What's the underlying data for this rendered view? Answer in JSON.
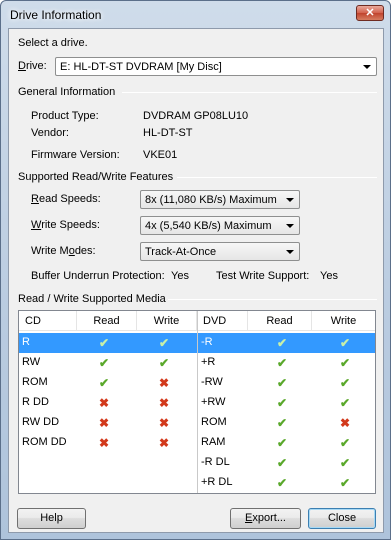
{
  "window": {
    "title": "Drive Information",
    "close_glyph": "✕"
  },
  "select_prompt": "Select a drive.",
  "drive": {
    "label_first": "D",
    "label_rest": "rive:",
    "value": "E: HL-DT-ST DVDRAM    [My Disc]"
  },
  "general": {
    "heading": "General Information",
    "product_type_label": "Product Type:",
    "product_type_value": "DVDRAM GP08LU10",
    "vendor_label": "Vendor:",
    "vendor_value": "HL-DT-ST",
    "firmware_label": "Firmware Version:",
    "firmware_value": "VKE01"
  },
  "rw_features": {
    "heading": "Supported Read/Write Features",
    "read_speeds_first": "R",
    "read_speeds_rest": "ead Speeds:",
    "read_speeds_value": "8x (11,080 KB/s)  Maximum",
    "write_speeds_first": "W",
    "write_speeds_rest": "rite Speeds:",
    "write_speeds_value": "4x (5,540 KB/s)  Maximum",
    "write_modes_label_a": "Write M",
    "write_modes_label_u": "o",
    "write_modes_label_b": "des:",
    "write_modes_value": "Track-At-Once",
    "buffer_label": "Buffer Underrun Protection:",
    "buffer_value": "Yes",
    "test_write_label": "Test Write Support:",
    "test_write_value": "Yes"
  },
  "media": {
    "heading": "Read / Write Supported Media",
    "cd_headers": [
      "CD",
      "Read",
      "Write"
    ],
    "dvd_headers": [
      "DVD",
      "Read",
      "Write"
    ],
    "cd_rows": [
      {
        "name": "R",
        "read": "check",
        "write": "check"
      },
      {
        "name": "RW",
        "read": "check",
        "write": "check"
      },
      {
        "name": "ROM",
        "read": "check",
        "write": "cross"
      },
      {
        "name": "R DD",
        "read": "cross",
        "write": "cross"
      },
      {
        "name": "RW DD",
        "read": "cross",
        "write": "cross"
      },
      {
        "name": "ROM DD",
        "read": "cross",
        "write": "cross"
      }
    ],
    "dvd_rows": [
      {
        "name": "-R",
        "read": "check",
        "write": "check"
      },
      {
        "name": "+R",
        "read": "check",
        "write": "check"
      },
      {
        "name": "-RW",
        "read": "check",
        "write": "check"
      },
      {
        "name": "+RW",
        "read": "check",
        "write": "check"
      },
      {
        "name": "ROM",
        "read": "check",
        "write": "cross"
      },
      {
        "name": "RAM",
        "read": "check",
        "write": "check"
      },
      {
        "name": "-R DL",
        "read": "check",
        "write": "check"
      },
      {
        "name": "+R DL",
        "read": "check",
        "write": "check"
      }
    ],
    "selected_row": 0
  },
  "buttons": {
    "help": "Help",
    "export_first": "E",
    "export_rest": "xport...",
    "close": "Close"
  },
  "icons": {
    "check": "✔",
    "cross": "✖"
  },
  "colors": {
    "selection": "#3399ff",
    "check": "#5aa82b",
    "cross": "#d2391c"
  }
}
